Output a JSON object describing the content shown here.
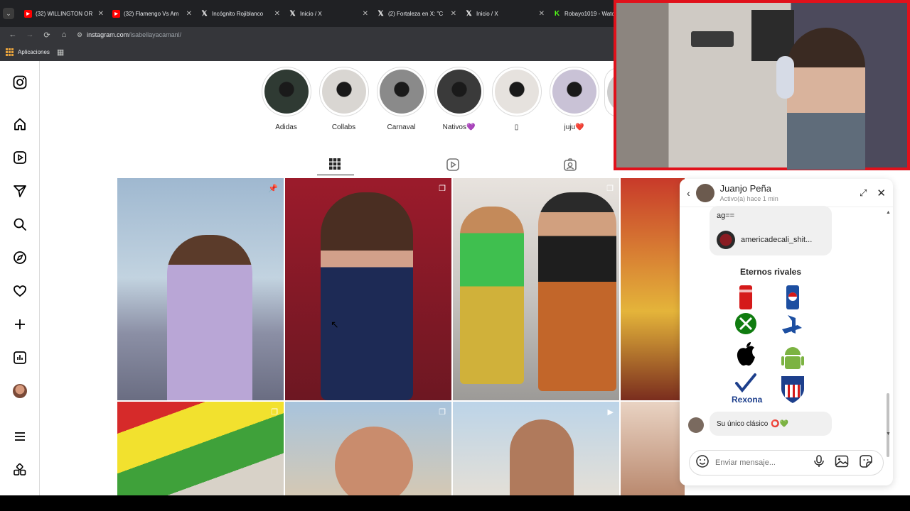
{
  "browser": {
    "tabs": [
      {
        "title": "(32) WILLINGTON OR",
        "icon": "youtube-icon"
      },
      {
        "title": "(32) Flamengo Vs Am",
        "icon": "youtube-icon"
      },
      {
        "title": "Incógnito Rojiblanco",
        "icon": "x-icon"
      },
      {
        "title": "Inicio / X",
        "icon": "x-icon"
      },
      {
        "title": "(2) Fortaleza en X: \"C",
        "icon": "x-icon"
      },
      {
        "title": "Inicio / X",
        "icon": "x-icon"
      },
      {
        "title": "Robayo1019 - Watch",
        "icon": "kick-icon"
      }
    ],
    "url_domain": "instagram.com",
    "url_path": "/isabellayacamanl/",
    "bookmarks_label": "Aplicaciones"
  },
  "profile": {
    "highlights": [
      {
        "label": "Adidas",
        "color": "#2f3a33"
      },
      {
        "label": "Collabs",
        "color": "#d9d6d2"
      },
      {
        "label": "Carnaval",
        "color": "#8a8a8a"
      },
      {
        "label": "Nativos💜",
        "color": "#3a3a3a"
      },
      {
        "label": "▯",
        "color": "#e6e2de"
      },
      {
        "label": "juju❤️",
        "color": "#c9c2d6"
      }
    ]
  },
  "chat": {
    "name": "Juanjo Peña",
    "status": "Activo(a) hace 1 min",
    "fragment": "ag==",
    "shared_account": "americadecali_shit...",
    "card_title": "Eternos rivales",
    "brand_label": "Rexona",
    "reply": "Su único clásico",
    "input_placeholder": "Enviar mensaje..."
  },
  "colors": {
    "accent_red": "#e0111b",
    "instagram_text": "#262626"
  }
}
